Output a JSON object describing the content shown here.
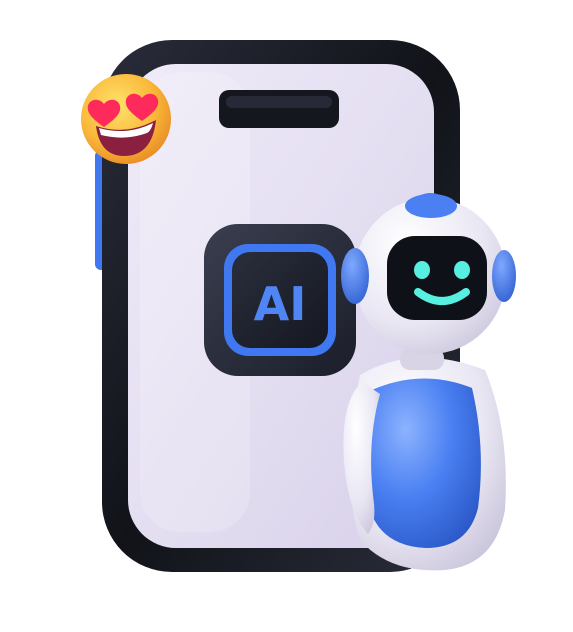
{
  "illustration": {
    "chip_label": "AI",
    "colors": {
      "phone_frame": "#14161f",
      "phone_screen": "#e6e1f2",
      "accent_blue": "#3f78f0",
      "robot_face": "#0f1118",
      "robot_eyes": "#57f0e0",
      "emoji_face": "#f7b93a",
      "emoji_hearts": "#ff2a5c"
    },
    "icons": {
      "emoji": "heart-eyes-emoji-icon",
      "chip": "ai-chip-icon",
      "robot": "robot-mascot-icon"
    }
  }
}
